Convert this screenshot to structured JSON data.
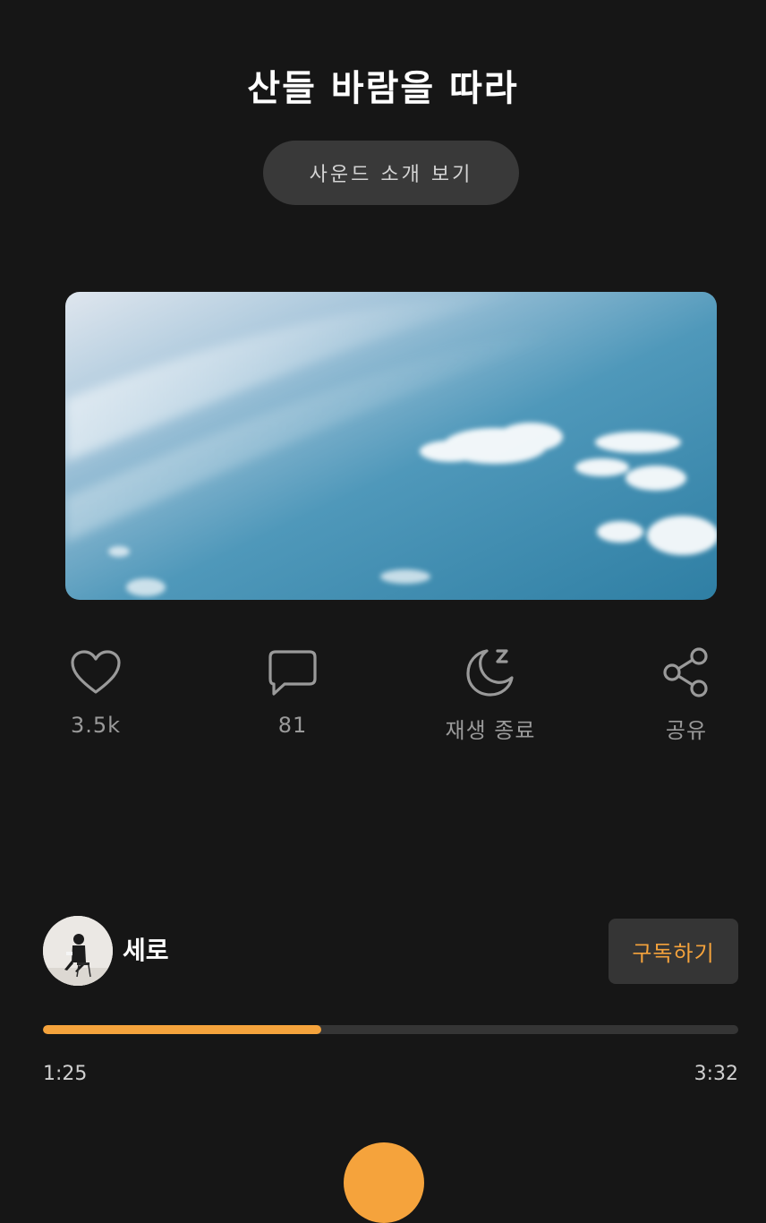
{
  "title": "산들 바람을 따라",
  "intro_button_label": "사운드 소개 보기",
  "actions": [
    {
      "label": "3.5k",
      "icon": "heart-icon"
    },
    {
      "label": "81",
      "icon": "comment-icon"
    },
    {
      "label": "재생 종료",
      "icon": "sleep-moon-icon"
    },
    {
      "label": "공유",
      "icon": "share-icon"
    }
  ],
  "creator": {
    "name": "세로"
  },
  "subscribe_label": "구독하기",
  "player": {
    "elapsed": "1:25",
    "total": "3:32",
    "progress_fraction": 0.4
  },
  "colors": {
    "background": "#161616",
    "accent": "#f5a33c",
    "muted_text": "#9a9a9a",
    "button_bg": "#393939"
  }
}
